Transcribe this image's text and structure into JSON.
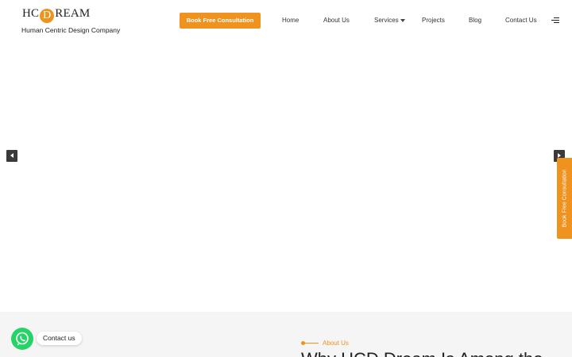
{
  "brand": {
    "logo_pre": "HC",
    "logo_letter": "D",
    "logo_post": "REAM",
    "tagline": "Human Centric Design Company",
    "accent_color": "#f0921e"
  },
  "header": {
    "cta_label": "Book Free Consultation",
    "nav": [
      {
        "label": "Home"
      },
      {
        "label": "About Us"
      },
      {
        "label": "Services",
        "has_dropdown": true
      },
      {
        "label": "Projects"
      },
      {
        "label": "Blog"
      },
      {
        "label": "Contact Us"
      }
    ],
    "menu_icon": "hamburger-menu-icon"
  },
  "slider": {
    "prev_icon": "arrow-left-icon",
    "next_icon": "arrow-right-icon"
  },
  "side_tab": {
    "label": "Book Free Consultation"
  },
  "about": {
    "eyebrow": "About Us",
    "heading": "Why HCD Dream Is Among the"
  },
  "whatsapp": {
    "label": "Contact us",
    "icon": "whatsapp-icon",
    "color": "#25d366"
  }
}
